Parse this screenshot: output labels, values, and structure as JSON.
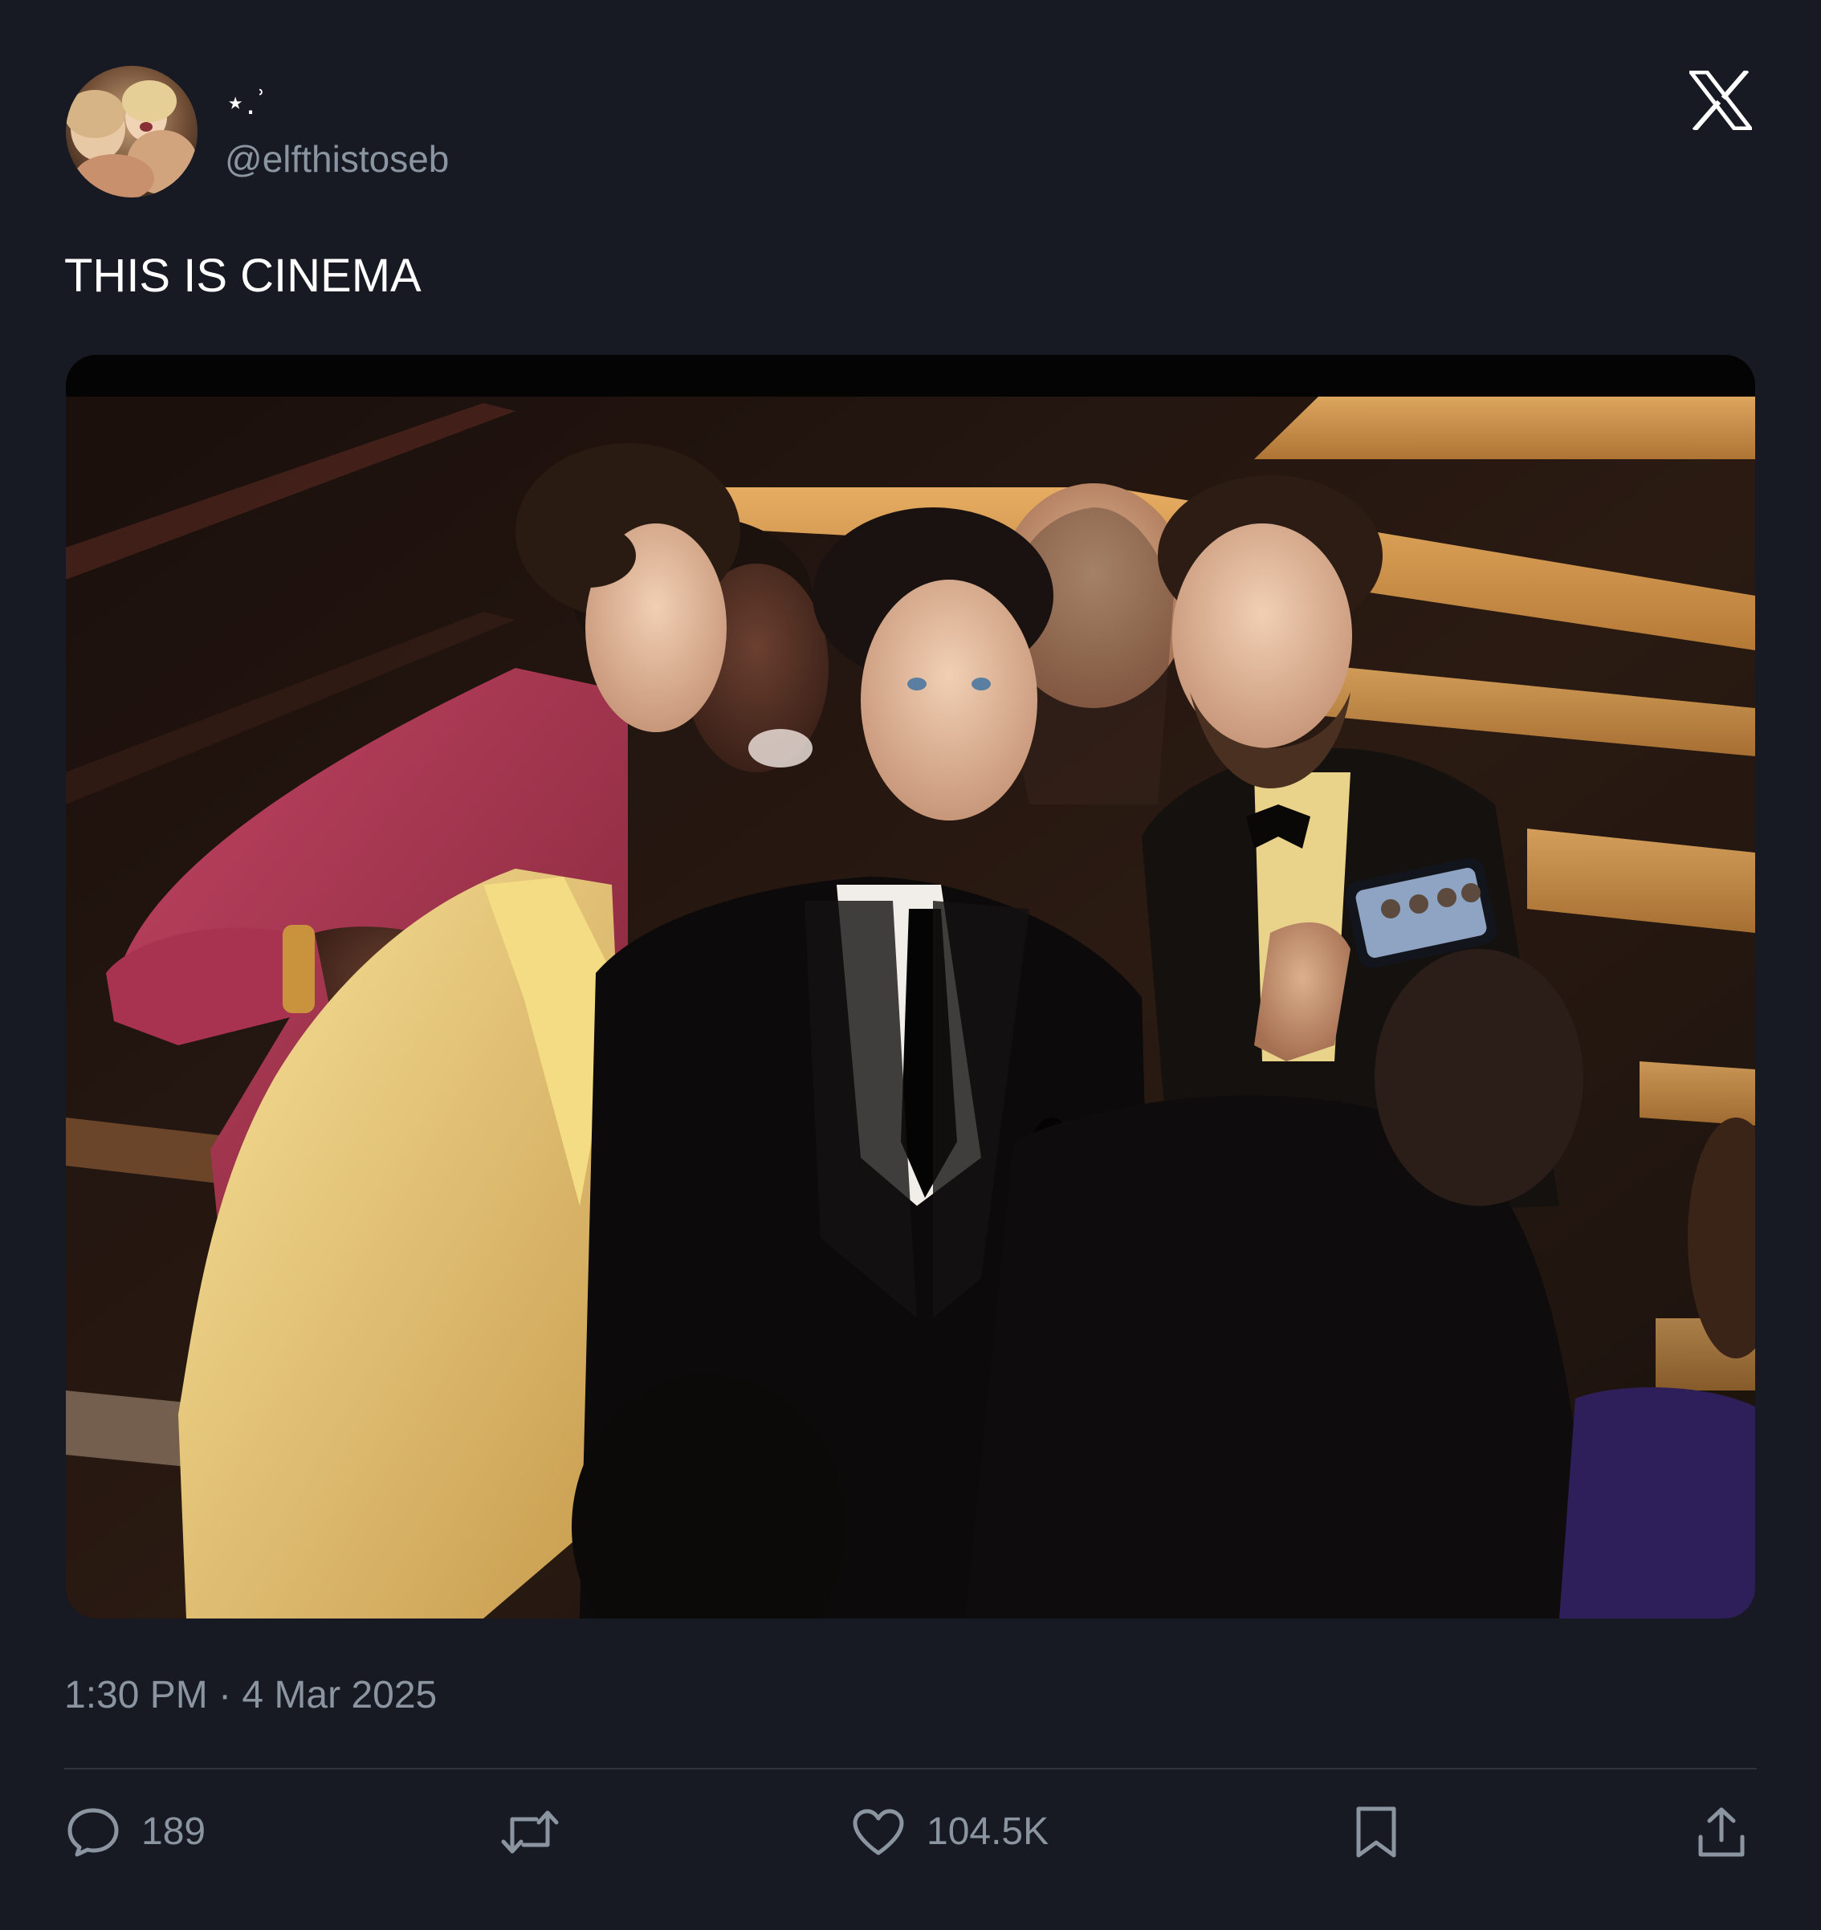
{
  "author": {
    "display_name": "⋆.ʾ",
    "handle": "@elfthistoseb"
  },
  "tweet": {
    "text": "THIS IS CINEMA",
    "timestamp": "1:30 PM · 4 Mar 2025"
  },
  "media": {
    "phone_screen_label": ""
  },
  "actions": {
    "reply_count": "189",
    "retweet_count": "",
    "like_count": "104.5K"
  },
  "icons": {
    "logo": "x-logo-icon",
    "reply": "reply-icon",
    "retweet": "retweet-icon",
    "like": "heart-icon",
    "bookmark": "bookmark-icon",
    "share": "share-icon"
  },
  "colors": {
    "background": "#171a22",
    "text_primary": "#ffffff",
    "text_secondary": "#8b95a1",
    "divider": "#2f3540"
  }
}
